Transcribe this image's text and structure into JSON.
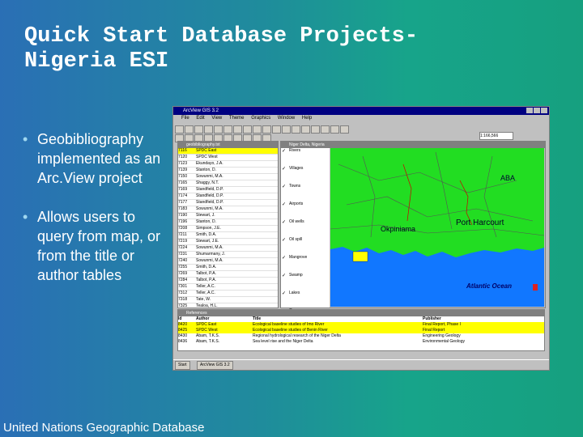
{
  "slide": {
    "title_lines": [
      "Quick Start Database Projects-",
      "Nigeria ESI"
    ],
    "bullets": [
      "Geobibliography implemented as an Arc.View project",
      "Allows users to query from map, or from the title or author tables"
    ],
    "footer": "United Nations Geographic Database"
  },
  "screenshot": {
    "app_title": "ArcView GIS 3.2",
    "menus": [
      "File",
      "Edit",
      "View",
      "Theme",
      "Graphics",
      "Window",
      "Help"
    ],
    "scale_value": "1:166,566",
    "attr_window_title": "geobibliography.txt",
    "attr_rows": [
      {
        "id": "7116",
        "name": "SPDC East"
      },
      {
        "id": "7120",
        "name": "SPDC West"
      },
      {
        "id": "7123",
        "name": "Ekundayo, J.A."
      },
      {
        "id": "7139",
        "name": "Stanton, D."
      },
      {
        "id": "7150",
        "name": "Sowunmi, M.A."
      },
      {
        "id": "7165",
        "name": "Shaggy, N.T."
      },
      {
        "id": "7169",
        "name": "Standfield, D.P."
      },
      {
        "id": "7174",
        "name": "Standfield, D.P."
      },
      {
        "id": "7177",
        "name": "Standfield, D.P."
      },
      {
        "id": "7183",
        "name": "Sowunmi, M.A."
      },
      {
        "id": "7190",
        "name": "Stewart, J."
      },
      {
        "id": "7196",
        "name": "Stanton, D."
      },
      {
        "id": "7208",
        "name": "Simpson, J.E."
      },
      {
        "id": "7211",
        "name": "Smith, D.A."
      },
      {
        "id": "7219",
        "name": "Stewart, J.E."
      },
      {
        "id": "7224",
        "name": "Sowunmi, M.A."
      },
      {
        "id": "7231",
        "name": "Shumarmany, J."
      },
      {
        "id": "7240",
        "name": "Sowunmi, M.A."
      },
      {
        "id": "7255",
        "name": "Smith, D.A."
      },
      {
        "id": "7269",
        "name": "Talbot, P.A."
      },
      {
        "id": "7284",
        "name": "Talbot, P.A."
      },
      {
        "id": "7301",
        "name": "Teller, A.C."
      },
      {
        "id": "7312",
        "name": "Teller, A.C."
      },
      {
        "id": "7318",
        "name": "Tate, W."
      },
      {
        "id": "7325",
        "name": "Tealoa, H.L."
      },
      {
        "id": "7330",
        "name": "Tealoa, H.L."
      }
    ],
    "view_title": "Niger Delta, Nigeria",
    "toc_items": [
      "Rivers",
      "Villages",
      "Towns",
      "Airports",
      "Oil wells",
      "Oil spill",
      "Mangrove",
      "Swamp",
      "Lakes",
      "Open ocean"
    ],
    "map_labels": {
      "aba": "ABA",
      "port_harcourt": "Port Harcourt",
      "okpiniama": "Okpiniama",
      "ocean": "Atlantic Ocean"
    },
    "table_window_title": "References",
    "table_headers": [
      "Id",
      "Author",
      "Title",
      "Publisher"
    ],
    "table_rows": [
      [
        "8420",
        "SPDC East",
        "Ecological baseline studies of Imo River",
        "Final Report, Phase I"
      ],
      [
        "8425",
        "SPDC West",
        "Ecological baseline studies of Benin River",
        "Final Report"
      ],
      [
        "8430",
        "Abam, T.K.S.",
        "Regional hydrological research of the Niger Delta",
        "Engineering Geology"
      ],
      [
        "8436",
        "Abam, T.K.S.",
        "Sea level rise and the Niger Delta",
        "Environmental Geology"
      ]
    ],
    "taskbar_items": [
      "Start",
      "ArcView GIS 3.2"
    ]
  },
  "colors": {
    "land": "#22dd22",
    "ocean": "#1177ff",
    "selection": "#ffff00",
    "title_bar": "#000080"
  }
}
